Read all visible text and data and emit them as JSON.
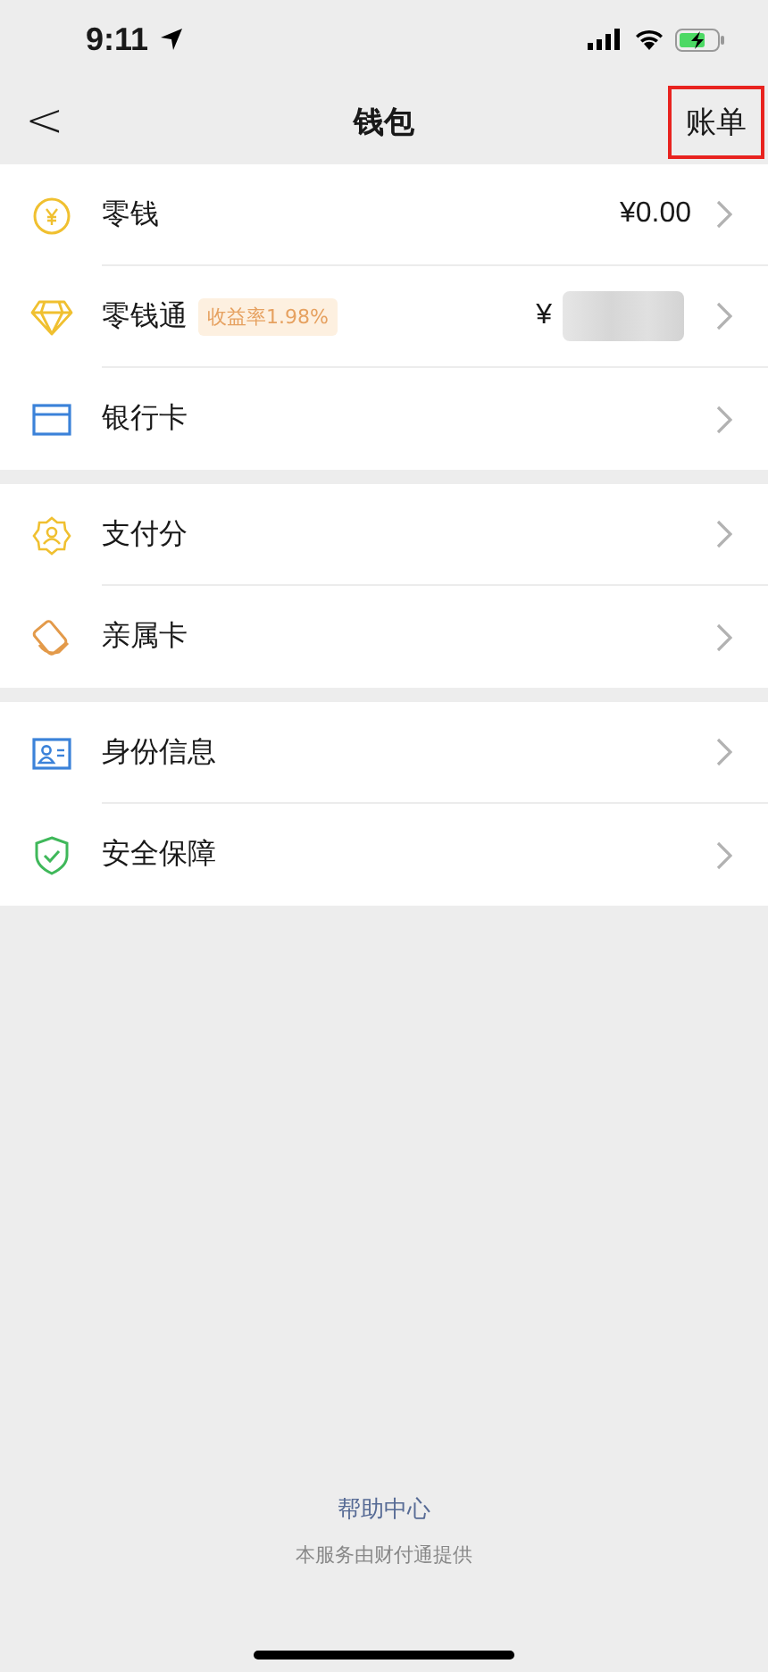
{
  "status_bar": {
    "time": "9:11"
  },
  "nav": {
    "back": "<",
    "title": "钱包",
    "action": {
      "label": "账单",
      "highlighted": true
    }
  },
  "sections": [
    {
      "rows": [
        {
          "label": "零钱",
          "value": "¥0.00"
        },
        {
          "label": "零钱通",
          "badge": "收益率1.98%",
          "value": "¥",
          "redacted": true
        },
        {
          "label": "银行卡"
        }
      ]
    },
    {
      "rows": [
        {
          "label": "支付分"
        },
        {
          "label": "亲属卡"
        }
      ]
    },
    {
      "rows": [
        {
          "label": "身份信息"
        },
        {
          "label": "安全保障"
        }
      ]
    }
  ],
  "footer": {
    "link": "帮助中心",
    "note": "本服务由财付通提供"
  }
}
